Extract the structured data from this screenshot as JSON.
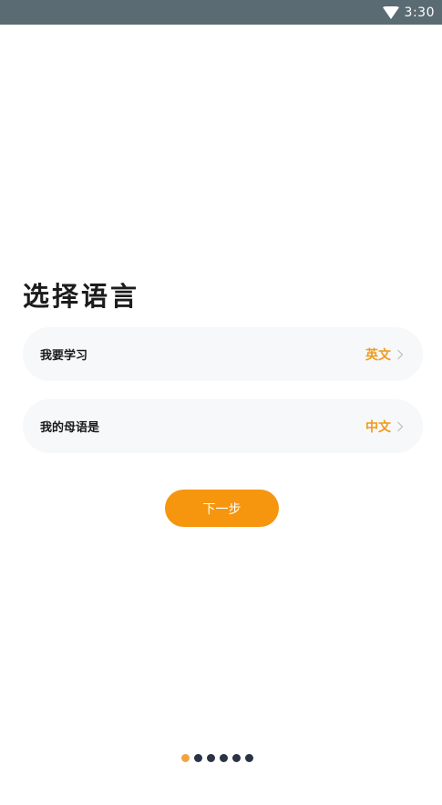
{
  "status_bar": {
    "time": "3:30",
    "wifi_icon": "wifi-icon"
  },
  "page": {
    "title": "选择语言"
  },
  "options": [
    {
      "label": "我要学习",
      "value": "英文"
    },
    {
      "label": "我的母语是",
      "value": "中文"
    }
  ],
  "next_button": {
    "label": "下一步"
  },
  "pager": {
    "total": 6,
    "active_index": 0
  },
  "colors": {
    "accent": "#f6960f",
    "value_text": "#f29a1b",
    "status_bar": "#5b6b73",
    "row_background": "#f6f8f9",
    "dot_inactive": "#2a3445",
    "dot_active": "#f3a243"
  }
}
